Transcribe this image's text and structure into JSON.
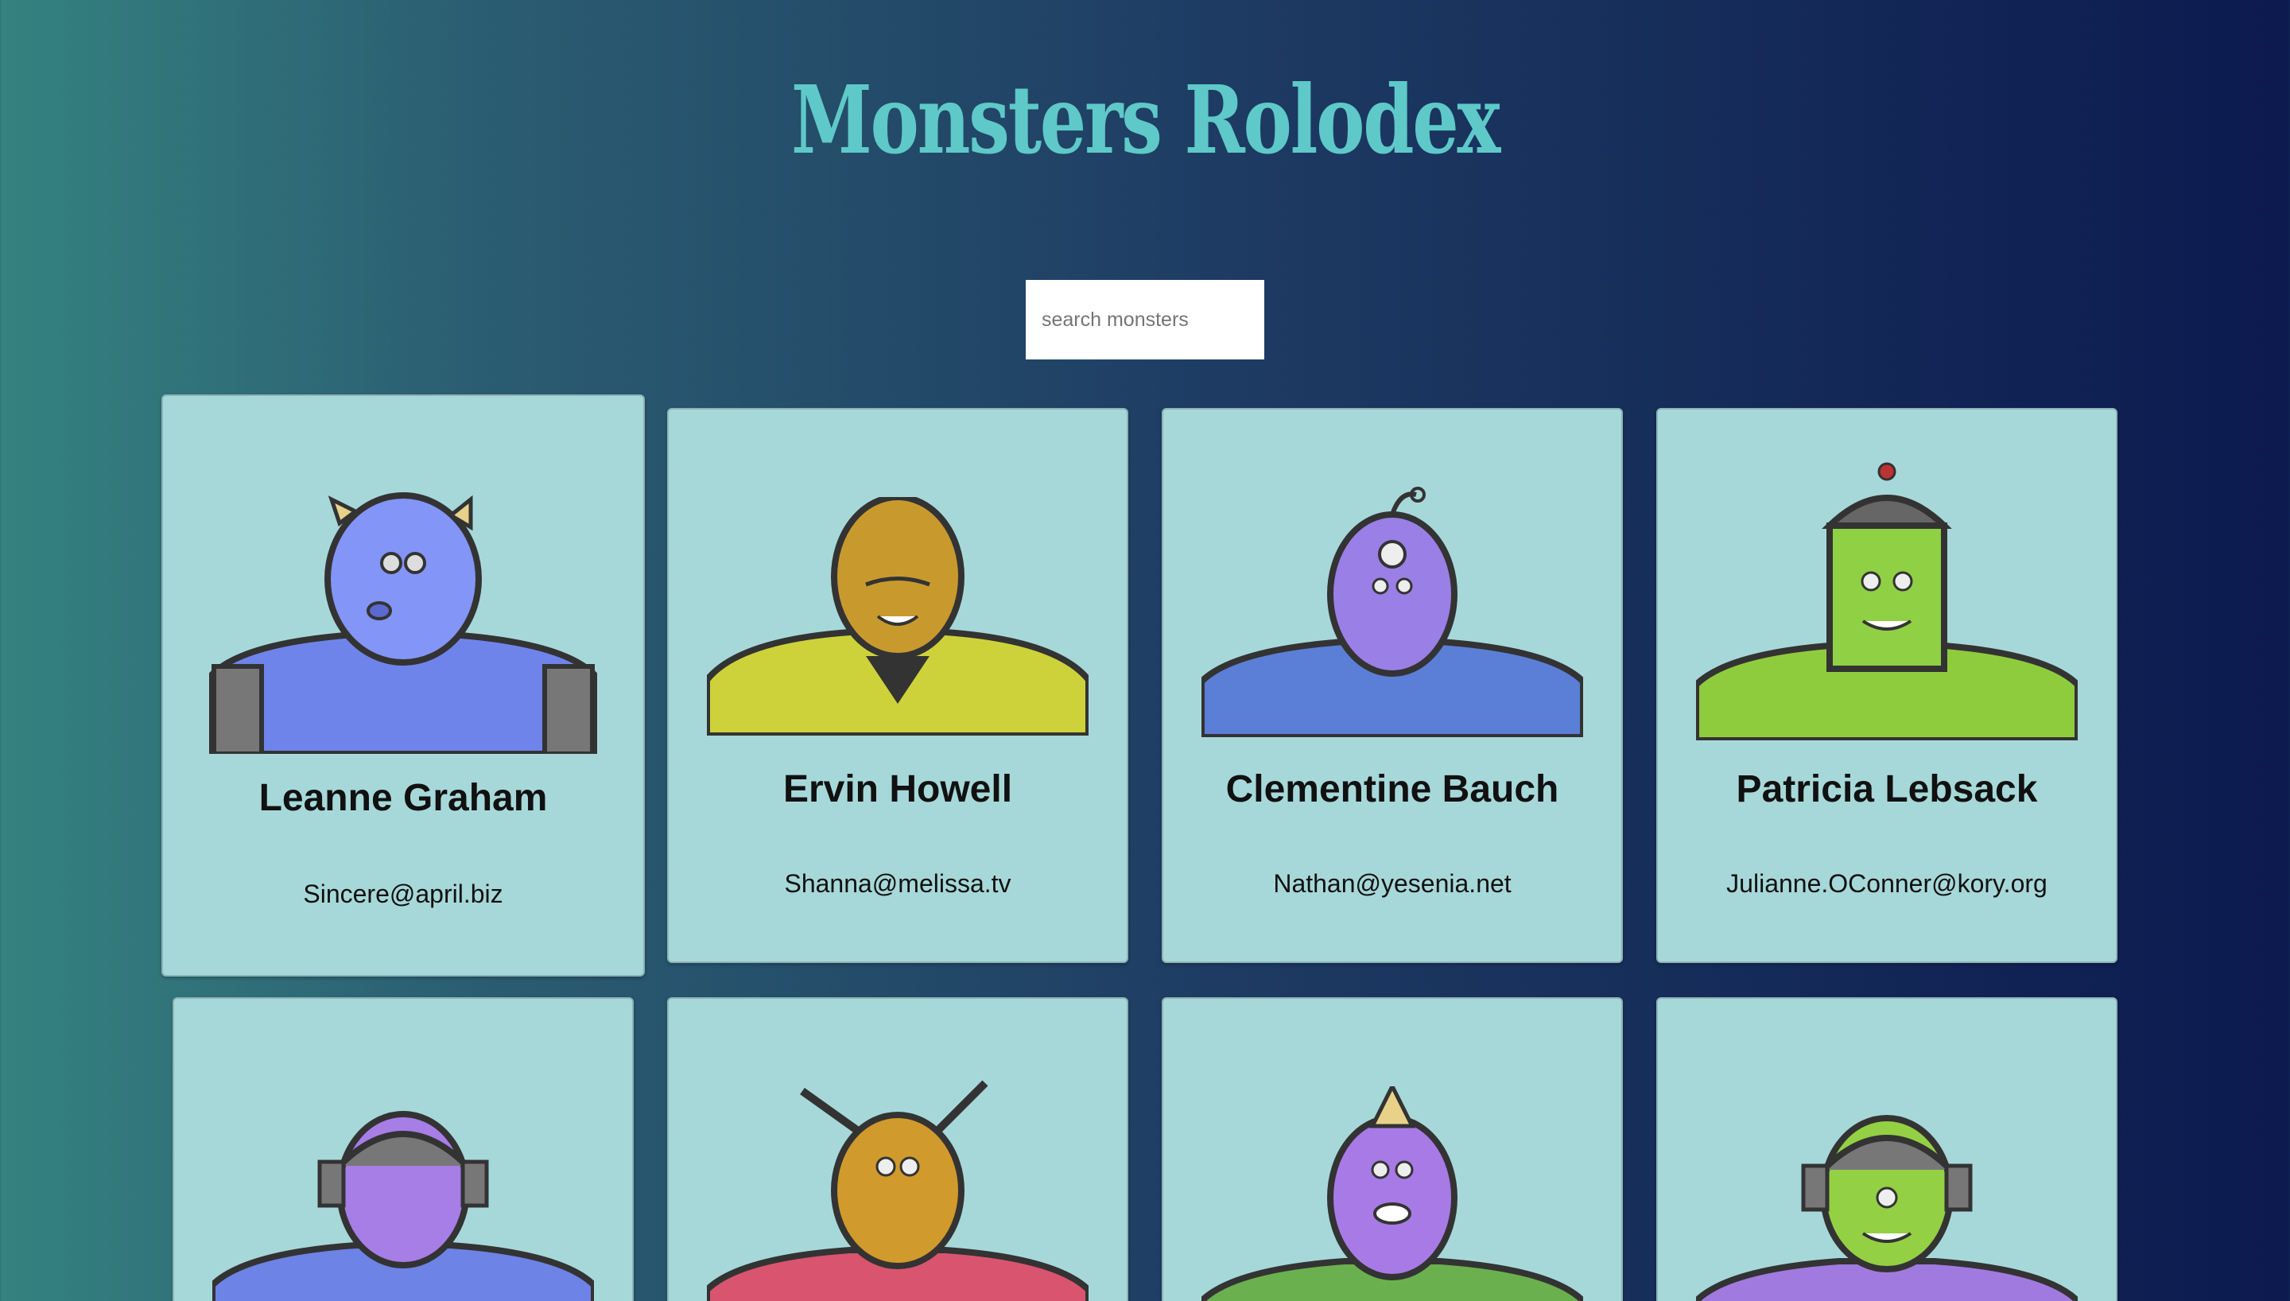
{
  "app": {
    "title": "Monsters Rolodex"
  },
  "search": {
    "placeholder": "search monsters"
  },
  "monsters": [
    {
      "name": "Leanne Graham",
      "email": "Sincere@april.biz",
      "color": "#7f8ff2",
      "feature": "horns"
    },
    {
      "name": "Ervin Howell",
      "email": "Shanna@melissa.tv",
      "color": "#c89a2e",
      "feature": "hood",
      "body": "#cdd23a"
    },
    {
      "name": "Clementine Bauch",
      "email": "Nathan@yesenia.net",
      "color": "#9a7fe6",
      "feature": "antenna-eye",
      "body": "#5b7fd6"
    },
    {
      "name": "Patricia Lebsack",
      "email": "Julianne.OConner@kory.org",
      "color": "#8fd044",
      "feature": "helmet",
      "body": "#8fcc3d"
    },
    {
      "name": "",
      "email": "",
      "color": "#a77de6",
      "feature": "headset",
      "body": "#6d83e6"
    },
    {
      "name": "",
      "email": "",
      "color": "#d09a2c",
      "feature": "antennae",
      "body": "#d9546f"
    },
    {
      "name": "",
      "email": "",
      "color": "#a87ae6",
      "feature": "horn",
      "body": "#6bb04e"
    },
    {
      "name": "",
      "email": "",
      "color": "#94d044",
      "feature": "headset",
      "body": "#a17ae0"
    }
  ]
}
